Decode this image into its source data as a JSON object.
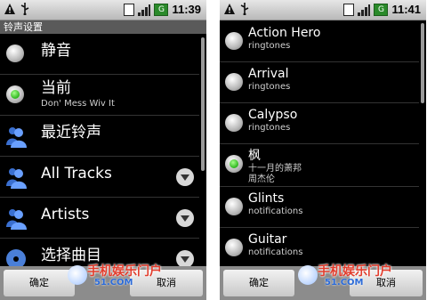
{
  "left_phone": {
    "status": {
      "time": "11:39",
      "battery_label": "G"
    },
    "title": "铃声设置",
    "items": [
      {
        "label": "静音",
        "type": "radio",
        "checked": false
      },
      {
        "label": "当前",
        "sub": "Don' Mess Wiv It",
        "type": "radio",
        "checked": true
      },
      {
        "label": "最近铃声",
        "type": "contact"
      },
      {
        "label": "All Tracks",
        "type": "contact",
        "expand": true
      },
      {
        "label": "Artists",
        "type": "contact",
        "expand": true
      },
      {
        "label": "选择曲目",
        "type": "contact",
        "expand": true
      }
    ],
    "buttons": {
      "ok": "确定",
      "cancel": "取消"
    }
  },
  "right_phone": {
    "status": {
      "time": "11:41",
      "battery_label": "G"
    },
    "items": [
      {
        "label": "Action Hero",
        "sub": "ringtones",
        "checked": false
      },
      {
        "label": "Arrival",
        "sub": "ringtones",
        "checked": false
      },
      {
        "label": "Calypso",
        "sub": "ringtones",
        "checked": false
      },
      {
        "label": "枫",
        "sub": "十一月的萧邦",
        "sub2": "周杰伦",
        "checked": true
      },
      {
        "label": "Glints",
        "sub": "notifications",
        "checked": false
      },
      {
        "label": "Guitar",
        "sub": "notifications",
        "checked": false
      }
    ],
    "buttons": {
      "ok": "确定",
      "cancel": "取消"
    }
  },
  "watermark": {
    "text": "手机娱乐门户",
    "url": "51.COM",
    "left_text": "手机娱乐门户",
    "left_url": "51.COM"
  },
  "colors": {
    "radio_on": "#2db51d",
    "watermark_red": "#e23d2d",
    "watermark_blue": "#2c6bd8"
  }
}
